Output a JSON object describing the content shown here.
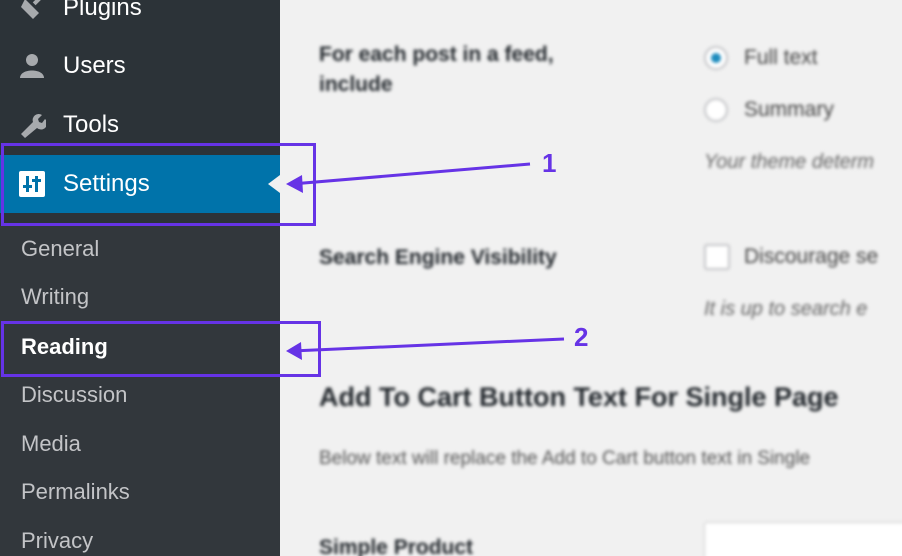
{
  "sidebar": {
    "items": [
      {
        "label": "Plugins",
        "icon": "plugin-icon"
      },
      {
        "label": "Users",
        "icon": "user-icon"
      },
      {
        "label": "Tools",
        "icon": "wrench-icon"
      },
      {
        "label": "Settings",
        "icon": "settings-sliders-icon",
        "active": true
      }
    ],
    "submenu": [
      "General",
      "Writing",
      "Reading",
      "Discussion",
      "Media",
      "Permalinks",
      "Privacy"
    ],
    "current_submenu": "Reading"
  },
  "content": {
    "feed_label": "For each post in a feed, include",
    "feed_options": [
      "Full text",
      "Summary"
    ],
    "feed_selected": "Full text",
    "theme_note": "Your theme determ",
    "sev_label": "Search Engine Visibility",
    "discourage_label": "Discourage se",
    "search_note": "It is up to search e",
    "section_heading": "Add To Cart Button Text For Single Page",
    "section_desc": "Below text will replace the Add to Cart button text in Single",
    "simple_product_label": "Simple Product"
  },
  "annotations": {
    "callout_1": "1",
    "callout_2": "2",
    "color": "#6633e6"
  },
  "colors": {
    "sidebar_bg": "#2c3338",
    "submenu_bg": "#32373c",
    "active_bg": "#0073aa",
    "content_bg": "#f1f1f1"
  }
}
